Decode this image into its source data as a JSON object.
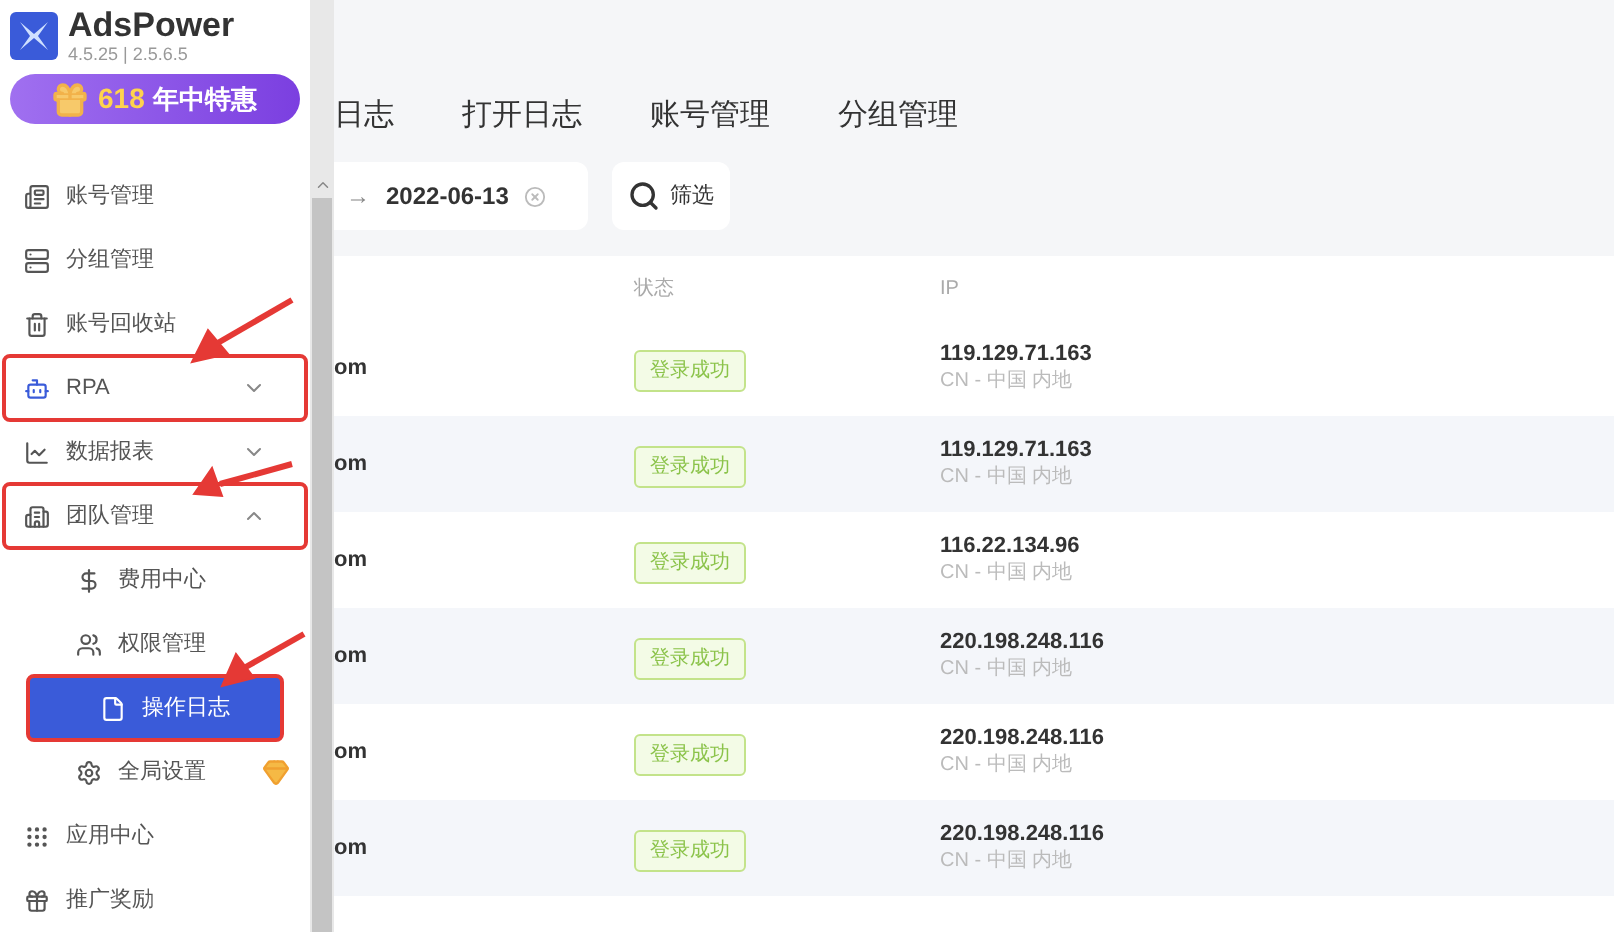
{
  "app": {
    "name": "AdsPower",
    "version": "4.5.25 | 2.5.6.5"
  },
  "promo": {
    "number": "618",
    "label": "年中特惠"
  },
  "sidebar": {
    "items": [
      {
        "label": "账号管理",
        "selected": false,
        "highlighted": false
      },
      {
        "label": "分组管理",
        "selected": false,
        "highlighted": false
      },
      {
        "label": "账号回收站",
        "selected": false,
        "highlighted": false
      },
      {
        "label": "RPA",
        "selected": false,
        "highlighted": true,
        "expanded": false
      },
      {
        "label": "数据报表",
        "selected": false,
        "highlighted": false,
        "expanded": false
      },
      {
        "label": "团队管理",
        "selected": false,
        "highlighted": true,
        "expanded": true,
        "children": [
          {
            "label": "费用中心",
            "selected": false,
            "highlighted": false
          },
          {
            "label": "权限管理",
            "selected": false,
            "highlighted": false
          },
          {
            "label": "操作日志",
            "selected": true,
            "highlighted": true
          },
          {
            "label": "全局设置",
            "selected": false,
            "highlighted": false,
            "badge": true
          }
        ]
      },
      {
        "label": "应用中心",
        "selected": false,
        "highlighted": false
      },
      {
        "label": "推广奖励",
        "selected": false,
        "highlighted": false
      }
    ]
  },
  "tabs": [
    {
      "label": "日志"
    },
    {
      "label": "打开日志"
    },
    {
      "label": "账号管理"
    },
    {
      "label": "分组管理"
    }
  ],
  "filter": {
    "arrow": "→",
    "date": "2022-06-13",
    "button": "筛选"
  },
  "table": {
    "columns": [
      "",
      "状态",
      "IP"
    ],
    "rows": [
      {
        "column_1": "om",
        "status": "登录成功",
        "ip": "119.129.71.163",
        "location": "CN - 中国 内地"
      },
      {
        "column_1": "om",
        "status": "登录成功",
        "ip": "119.129.71.163",
        "location": "CN - 中国 内地"
      },
      {
        "column_1": "om",
        "status": "登录成功",
        "ip": "116.22.134.96",
        "location": "CN - 中国 内地"
      },
      {
        "column_1": "om",
        "status": "登录成功",
        "ip": "220.198.248.116",
        "location": "CN - 中国 内地"
      },
      {
        "column_1": "om",
        "status": "登录成功",
        "ip": "220.198.248.116",
        "location": "CN - 中国 内地"
      },
      {
        "column_1": "om",
        "status": "登录成功",
        "ip": "220.198.248.116",
        "location": "CN - 中国 内地"
      }
    ]
  }
}
